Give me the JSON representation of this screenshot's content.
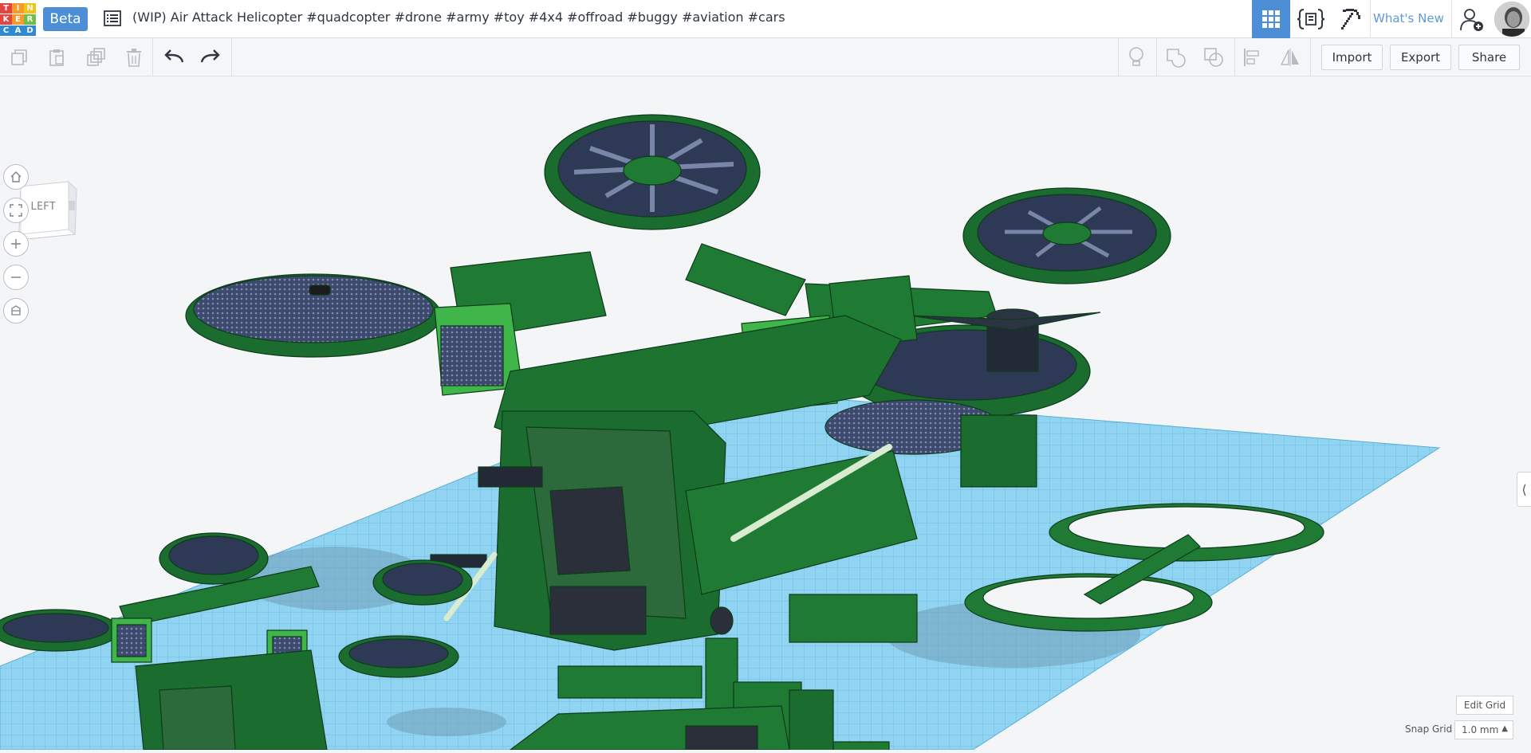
{
  "app": {
    "logo_letters": [
      "T",
      "I",
      "N",
      "K",
      "E",
      "R",
      "C",
      "A",
      "D"
    ],
    "logo_colors": [
      "#e2453f",
      "#f89a2a",
      "#f0c419",
      "#e2453f",
      "#f89a2a",
      "#6fbf44",
      "#2f8ad3",
      "#2f8ad3",
      "#2f8ad3"
    ],
    "beta_label": "Beta",
    "design_title": "(WIP) Air Attack Helicopter #quadcopter #drone #army #toy #4x4 #offroad #buggy #aviation #cars",
    "whats_new": "What's New"
  },
  "toolbar": {
    "import_label": "Import",
    "export_label": "Export",
    "share_label": "Share"
  },
  "viewcube": {
    "face_label": "LEFT"
  },
  "grid_controls": {
    "edit_grid_label": "Edit Grid",
    "snap_grid_label": "Snap Grid",
    "snap_grid_value": "1.0 mm"
  },
  "colors": {
    "accent": "#4c8fd6",
    "model_green": "#1f7a34",
    "model_light_green": "#3fb54a",
    "workplane_blue": "#8fd3f1",
    "grid_line": "#5fb3da"
  }
}
